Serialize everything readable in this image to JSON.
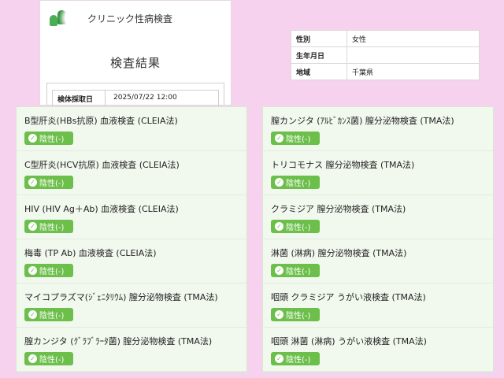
{
  "report": {
    "clinic_name": "クリニック性病検査",
    "title": "検査結果",
    "collection_label": "検体採取日",
    "collection_value": "2025/07/22 12:00"
  },
  "patient": {
    "rows": [
      {
        "label": "性別",
        "value": "女性"
      },
      {
        "label": "生年月日",
        "value": ""
      },
      {
        "label": "地域",
        "value": "千葉県"
      }
    ]
  },
  "results_left": [
    {
      "name": "B型肝炎(HBs抗原) 血液検査 (CLEIA法)",
      "result": "陰性(-)"
    },
    {
      "name": "C型肝炎(HCV抗原) 血液検査 (CLEIA法)",
      "result": "陰性(-)"
    },
    {
      "name": "HIV (HIV Ag＋Ab) 血液検査 (CLEIA法)",
      "result": "陰性(-)"
    },
    {
      "name": "梅毒 (TP Ab) 血液検査 (CLEIA法)",
      "result": "陰性(-)"
    },
    {
      "name": "マイコプラズマ(ｼﾞｪﾆﾀﾘｳﾑ) 膣分泌物検査 (TMA法)",
      "result": "陰性(-)"
    },
    {
      "name": "膣カンジタ (ｸﾞﾗﾌﾞﾗｰﾀ菌) 膣分泌物検査 (TMA法)",
      "result": "陰性(-)"
    }
  ],
  "results_right": [
    {
      "name": "膣カンジタ (ｱﾙﾋﾞｶﾝｽ菌) 膣分泌物検査 (TMA法)",
      "result": "陰性(-)"
    },
    {
      "name": "トリコモナス 膣分泌物検査 (TMA法)",
      "result": "陰性(-)"
    },
    {
      "name": "クラミジア 膣分泌物検査 (TMA法)",
      "result": "陰性(-)"
    },
    {
      "name": "淋菌 (淋病)  膣分泌物検査 (TMA法)",
      "result": "陰性(-)"
    },
    {
      "name": "咽頭 クラミジア うがい液検査 (TMA法)",
      "result": "陰性(-)"
    },
    {
      "name": "咽頭 淋菌 (淋病)  うがい液検査 (TMA法)",
      "result": "陰性(-)"
    }
  ],
  "icons": {
    "logo": "clinic-logo-icon",
    "check": "check-circle-icon"
  },
  "colors": {
    "background": "#f7d2ee",
    "badge": "#6cbf4a",
    "row": "#f1f8ee"
  }
}
